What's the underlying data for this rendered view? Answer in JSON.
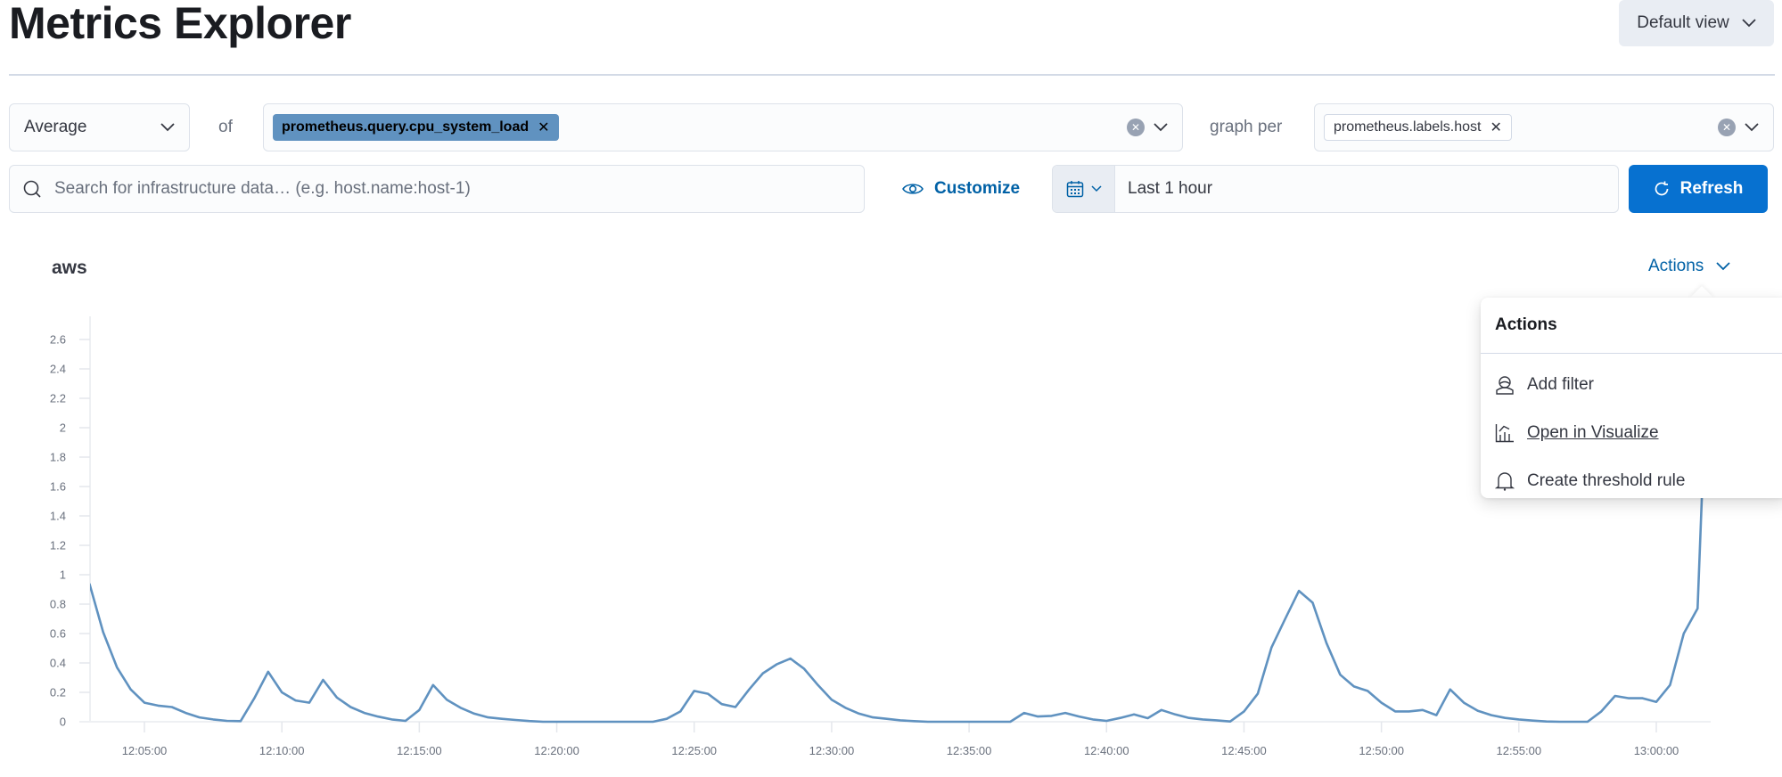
{
  "header": {
    "title": "Metrics Explorer",
    "view_selector": "Default view"
  },
  "toolbar": {
    "aggregation": "Average",
    "of_label": "of",
    "metric_chip": "prometheus.query.cpu_system_load",
    "graph_per_label": "graph per",
    "group_by_chip": "prometheus.labels.host",
    "search_placeholder": "Search for infrastructure data… (e.g. host.name:host-1)",
    "search_value": "",
    "customize_label": "Customize",
    "date_range": "Last 1 hour",
    "refresh_label": "Refresh"
  },
  "panel": {
    "title": "aws",
    "actions_label": "Actions"
  },
  "actions_menu": {
    "title": "Actions",
    "items": [
      {
        "label": "Add filter",
        "icon": "filter-user-icon"
      },
      {
        "label": "Open in Visualize",
        "icon": "visualize-chart-icon"
      },
      {
        "label": "Create threshold rule",
        "icon": "bell-icon"
      }
    ]
  },
  "colors": {
    "series": "#6092c0",
    "primary": "#0771d0",
    "link": "#0061a6"
  },
  "chart_data": {
    "type": "line",
    "title": "aws",
    "xlabel": "",
    "ylabel": "",
    "series_name": "prometheus.query.cpu_system_load",
    "x_start": "12:03:00",
    "x_step_seconds": 30,
    "x_range": [
      "12:03:00",
      "13:02:00"
    ],
    "ylim": [
      0,
      2.75
    ],
    "grid": false,
    "yticks": [
      "0",
      "0.2",
      "0.4",
      "0.6",
      "0.8",
      "1",
      "1.2",
      "1.4",
      "1.6",
      "1.8",
      "2",
      "2.2",
      "2.4",
      "2.6"
    ],
    "xticks": [
      "12:05:00",
      "12:10:00",
      "12:15:00",
      "12:20:00",
      "12:25:00",
      "12:30:00",
      "12:35:00",
      "12:40:00",
      "12:45:00",
      "12:50:00",
      "12:55:00",
      "13:00:00"
    ],
    "values": [
      0.94,
      0.61,
      0.37,
      0.22,
      0.13,
      0.11,
      0.1,
      0.06,
      0.03,
      0.016,
      0.006,
      0.004,
      0.16,
      0.34,
      0.2,
      0.145,
      0.13,
      0.285,
      0.165,
      0.1,
      0.06,
      0.035,
      0.016,
      0.006,
      0.08,
      0.25,
      0.15,
      0.095,
      0.055,
      0.03,
      0.02,
      0.012,
      0.005,
      0,
      0,
      0,
      0,
      0,
      0,
      0,
      0,
      0,
      0.02,
      0.07,
      0.21,
      0.19,
      0.12,
      0.1,
      0.22,
      0.33,
      0.39,
      0.43,
      0.36,
      0.25,
      0.15,
      0.095,
      0.055,
      0.03,
      0.02,
      0.01,
      0.004,
      0,
      0,
      0,
      0,
      0,
      0,
      0,
      0.06,
      0.036,
      0.04,
      0.06,
      0.036,
      0.016,
      0.006,
      0.026,
      0.05,
      0.024,
      0.08,
      0.05,
      0.026,
      0.016,
      0.01,
      0.002,
      0.07,
      0.19,
      0.505,
      0.7,
      0.89,
      0.81,
      0.535,
      0.32,
      0.24,
      0.21,
      0.13,
      0.07,
      0.07,
      0.08,
      0.045,
      0.22,
      0.13,
      0.075,
      0.045,
      0.026,
      0.016,
      0.008,
      0.002,
      0,
      0,
      0,
      0.07,
      0.176,
      0.16,
      0.16,
      0.135,
      0.25,
      0.6,
      0.77,
      3.2
    ]
  }
}
